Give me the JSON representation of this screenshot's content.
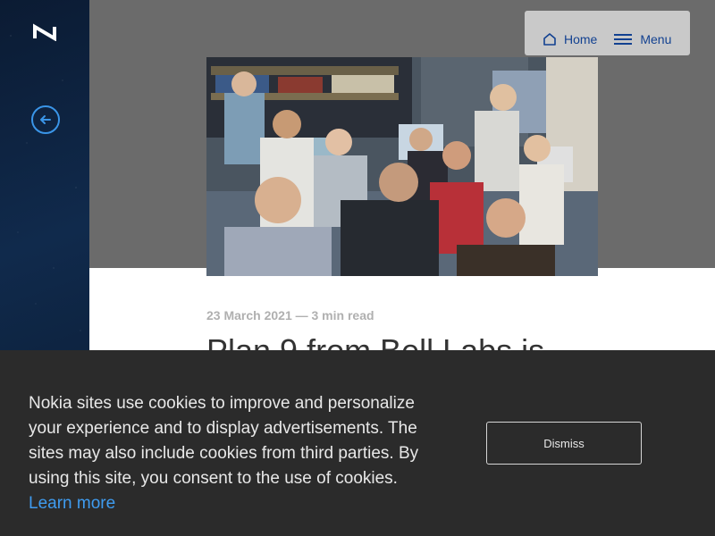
{
  "header": {
    "home_label": "Home",
    "menu_label": "Menu"
  },
  "article": {
    "meta": "23 March 2021 — 3 min read",
    "title": "Plan 9 from Bell Labs is"
  },
  "cookie_banner": {
    "text": "Nokia sites use cookies to improve and personalize your experience and to display advertisements. The sites may also include cookies from third parties. By using this site, you consent to the use of cookies. ",
    "learn_more_label": "Learn more",
    "dismiss_label": "Dismiss"
  },
  "colors": {
    "brand_blue": "#124191",
    "accent_blue": "#3a95e8",
    "hero_grey": "#6b6b6b",
    "cookie_bg": "#2b2b2b"
  },
  "icons": [
    "nokia-logo",
    "back-arrow-icon",
    "home-icon",
    "menu-icon"
  ]
}
